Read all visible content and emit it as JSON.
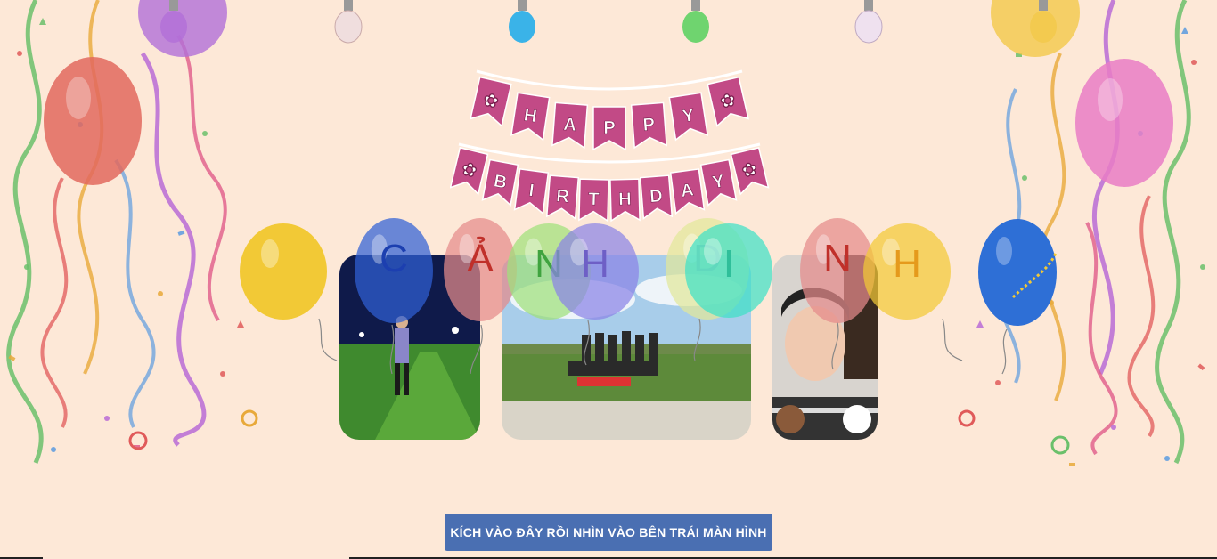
{
  "banner": {
    "line1": [
      "H",
      "A",
      "P",
      "P",
      "Y"
    ],
    "line2": [
      "B",
      "I",
      "R",
      "T",
      "H",
      "D",
      "A",
      "Y"
    ]
  },
  "letters": [
    {
      "char": "C",
      "color": "#1c3fb0"
    },
    {
      "char": "Ả",
      "color": "#c0302a"
    },
    {
      "char": "N",
      "color": "#3fa33f"
    },
    {
      "char": "H",
      "color": "#6e5fc6"
    },
    {
      "char": "D",
      "color": "#b9c0aa"
    },
    {
      "char": "I",
      "color": "#2fbf9a"
    },
    {
      "char": "N",
      "color": "#c0302a"
    },
    {
      "char": "H",
      "color": "#e59a1c"
    }
  ],
  "photos": [
    {
      "name": "photo-portrait-field"
    },
    {
      "name": "photo-group-field"
    },
    {
      "name": "photo-selfie"
    }
  ],
  "cta": {
    "label": "KÍCH VÀO ĐÂY RỒI NHÌN VÀO BÊN TRÁI MÀN HÌNH"
  },
  "colors": {
    "background": "#fde8d7",
    "button": "#4a6fb2"
  }
}
